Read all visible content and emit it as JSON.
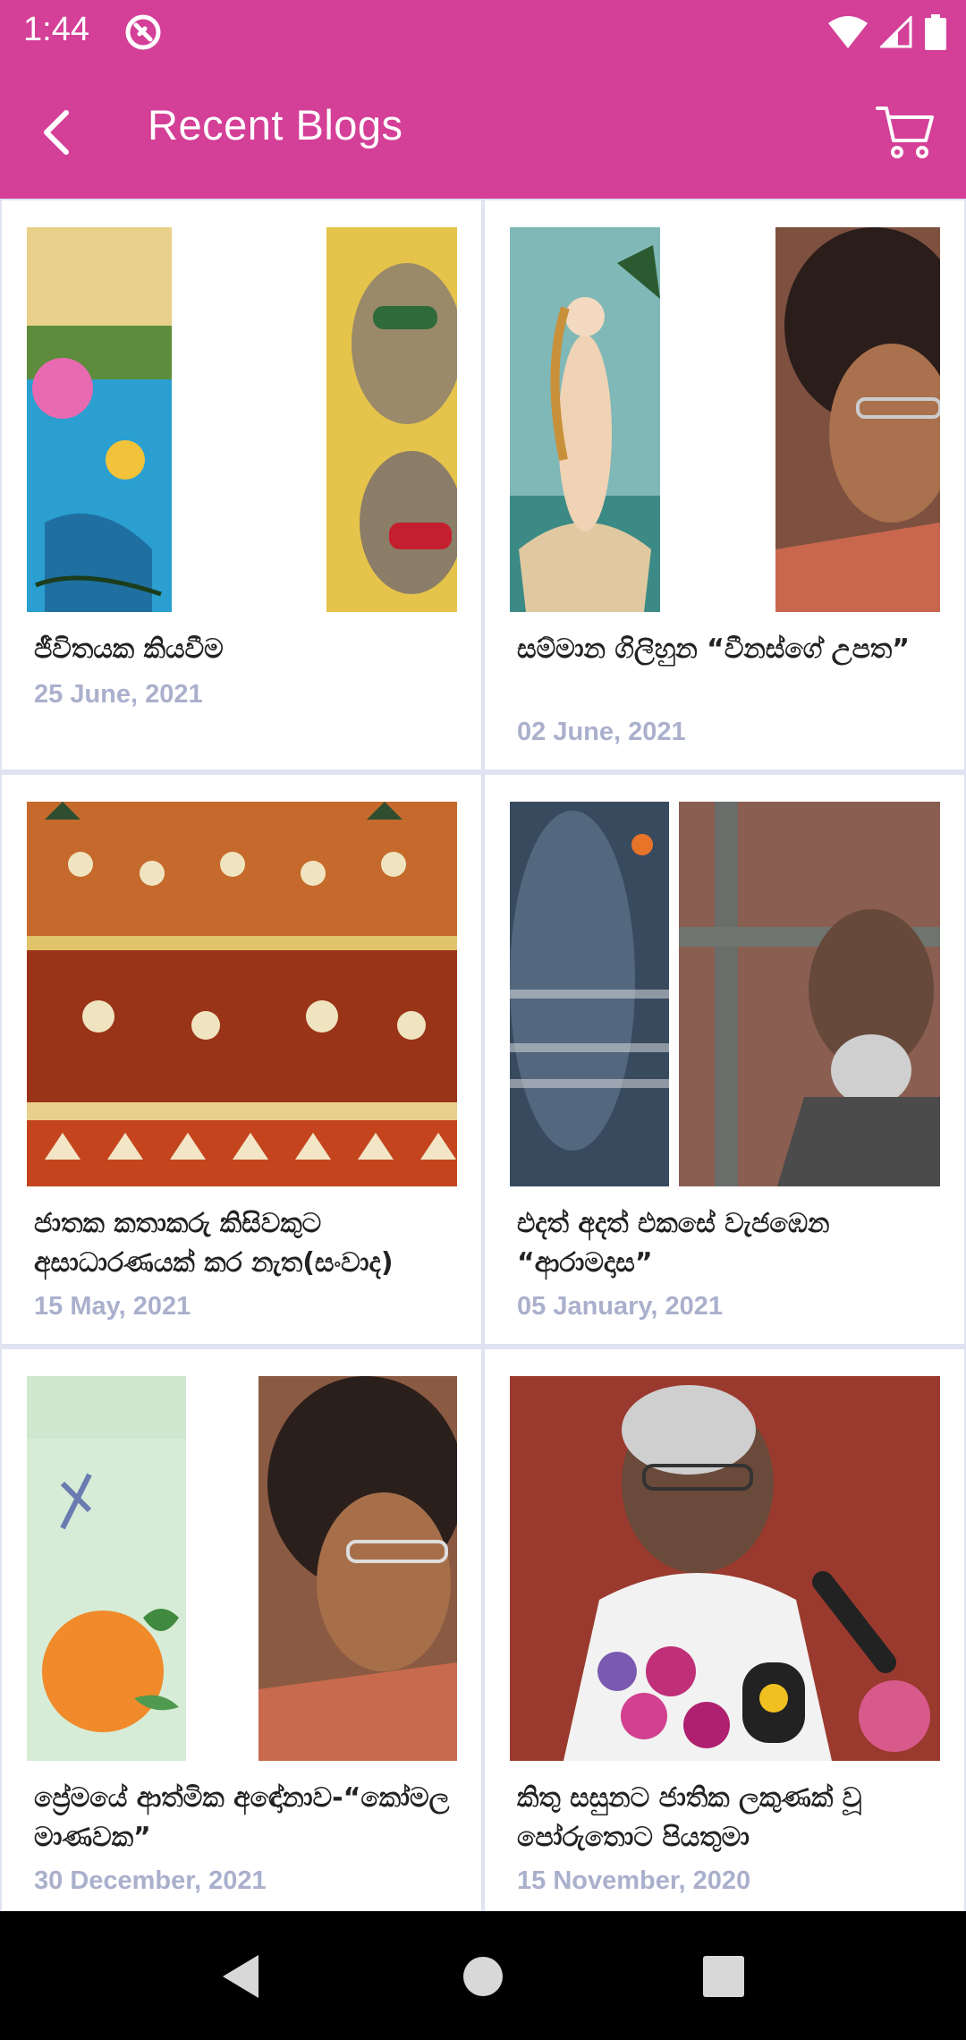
{
  "status_bar": {
    "time": "1:44",
    "icons": [
      "app-notification-icon",
      "wifi-icon",
      "signal-icon",
      "battery-icon"
    ]
  },
  "header": {
    "title": "Recent Blogs",
    "back_icon": "chevron-left-icon",
    "cart_icon": "cart-icon"
  },
  "colors": {
    "primary": "#d43f97",
    "date_text": "#aab0cc",
    "grid_divider": "#dfe3f2"
  },
  "blogs": [
    {
      "title": "ජීවිතයක කියවීම",
      "date": "25 June, 2021"
    },
    {
      "title": "සම්මාන ගිලිහුන “වීනස්ගේ උපත”",
      "date": "02 June, 2021"
    },
    {
      "title": "ජාතක කතාකරු කිසිවකුට අසාධාරණයක් කර නැත(සංවාද)",
      "date": "15 May, 2021"
    },
    {
      "title": "එදත් අදත් එකසේ වැජඹෙන “ආරාමදාස”",
      "date": "05 January, 2021"
    },
    {
      "title": "ප්‍රේමයේ ආත්මික අඳෝනාව-“කෝමල මාණවක”",
      "date": "30 December, 2021"
    },
    {
      "title": "කිතු සසුනට ජාතික ලකුණක් වූ පෝරුතොට පියතුමා",
      "date": "15 November, 2020"
    }
  ],
  "nav": {
    "icons": [
      "back-triangle-icon",
      "home-circle-icon",
      "recents-square-icon"
    ]
  }
}
